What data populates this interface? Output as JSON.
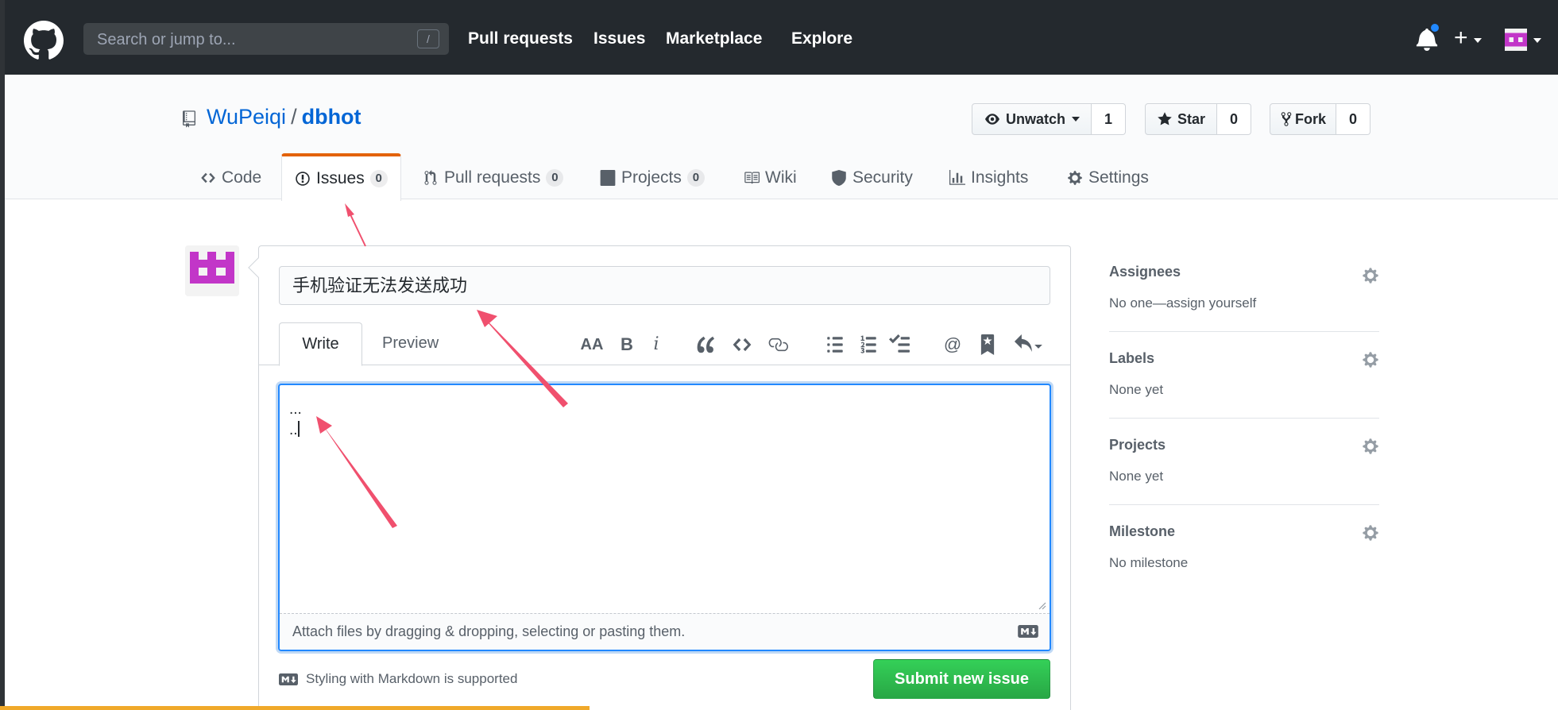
{
  "header": {
    "search_placeholder": "Search or jump to...",
    "search_shortcut": "/",
    "nav": [
      "Pull requests",
      "Issues",
      "Marketplace",
      "Explore"
    ],
    "plus": "+"
  },
  "repo": {
    "owner": "WuPeiqi",
    "separator": "/",
    "name": "dbhot",
    "watch_label": "Unwatch",
    "watch_count": "1",
    "star_label": "Star",
    "star_count": "0",
    "fork_label": "Fork",
    "fork_count": "0"
  },
  "tabs": [
    {
      "label": "Code"
    },
    {
      "label": "Issues",
      "count": "0"
    },
    {
      "label": "Pull requests",
      "count": "0"
    },
    {
      "label": "Projects",
      "count": "0"
    },
    {
      "label": "Wiki"
    },
    {
      "label": "Security"
    },
    {
      "label": "Insights"
    },
    {
      "label": "Settings"
    }
  ],
  "issue": {
    "title_value": "手机验证无法发送成功",
    "write_tab": "Write",
    "preview_tab": "Preview",
    "toolbar": {
      "header": "AA",
      "bold": "B",
      "italic": "i",
      "mention": "@"
    },
    "body_line1": "...",
    "body_line2": "..",
    "attach_text": "Attach files by dragging & dropping, selecting or pasting them.",
    "markdown_note": "Styling with Markdown is supported",
    "submit_label": "Submit new issue"
  },
  "sidebar": {
    "assignees": {
      "heading": "Assignees",
      "value": "No one—assign yourself"
    },
    "labels": {
      "heading": "Labels",
      "value": "None yet"
    },
    "projects": {
      "heading": "Projects",
      "value": "None yet"
    },
    "milestone": {
      "heading": "Milestone",
      "value": "No milestone"
    }
  },
  "colors": {
    "header_bg": "#24292e",
    "link": "#0366d6",
    "selected_tab_accent": "#e36209",
    "submit_green": "#28a745",
    "annotation_arrow": "#f0506e",
    "avatar_magenta": "#c236c8"
  }
}
